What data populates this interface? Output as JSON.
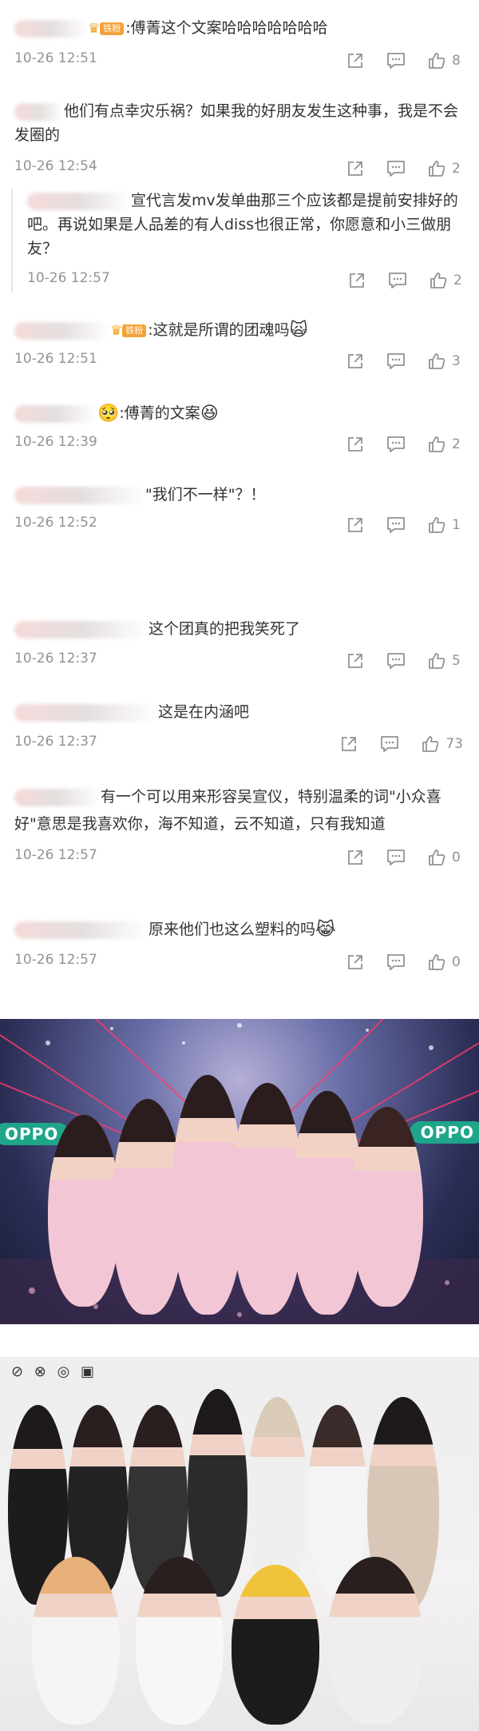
{
  "comments": [
    {
      "id": "c1",
      "badge": "铁粉",
      "text": ":傅菁这个文案哈哈哈哈哈哈哈",
      "time": "10-26 12:51",
      "likes": "8"
    },
    {
      "id": "c2",
      "text": "他们有点幸灾乐祸？如果我的好朋友发生这种事，我是不会发圈的",
      "time": "10-26 12:54",
      "likes": "2"
    },
    {
      "id": "c3",
      "text": "宣代言发mv发单曲那三个应该都是提前安排好的吧。再说如果是人品差的有人diss也很正常，你愿意和小三做朋友？",
      "time": "10-26 12:57",
      "likes": "2"
    },
    {
      "id": "c4",
      "badge": "铁粉",
      "text": ":这就是所谓的团魂吗",
      "time": "10-26 12:51",
      "likes": "3"
    },
    {
      "id": "c5",
      "text": ":傅菁的文案",
      "time": "10-26 12:39",
      "likes": "2"
    },
    {
      "id": "c6",
      "text": "\"我们不一样\"？！",
      "time": "10-26 12:52",
      "likes": "1"
    },
    {
      "id": "c7",
      "text": "这个团真的把我笑死了",
      "time": "10-26 12:37",
      "likes": "5"
    },
    {
      "id": "c8",
      "text": "这是在内涵吧",
      "time": "10-26 12:37",
      "likes": "73"
    },
    {
      "id": "c9",
      "text": "有一个可以用来形容吴宣仪，特别温柔的词\"小众喜好\"意思是我喜欢你，海不知道，云不知道，只有我知道",
      "time": "10-26 12:57",
      "likes": "0"
    },
    {
      "id": "c10",
      "text": "原来他们也这么塑料的吗",
      "time": "10-26 12:57",
      "likes": "0"
    }
  ],
  "icons": {
    "share": "share-icon",
    "comment": "comment-icon",
    "like": "thumbs-up-icon",
    "crown": "crown-icon",
    "laugh_emoji": "laughing-emoji",
    "cat_emoji": "cat-face-emoji",
    "tears_emoji": "tears-of-joy-emoji",
    "pleading_emoji": "pleading-face-emoji"
  },
  "photos": {
    "stage_logo_left": "OPPO",
    "stage_logo_right": "OPPO",
    "studio_logo_marks": "⊘ ⊗ ◎ ▣"
  },
  "colors": {
    "text": "#333333",
    "meta": "#939393",
    "badge": "#f3a23a",
    "crown": "#f5a21f",
    "divider": "#e6e6e6",
    "oppo_green": "#1fa58a",
    "outfit_pink": "#f3c6d6"
  }
}
